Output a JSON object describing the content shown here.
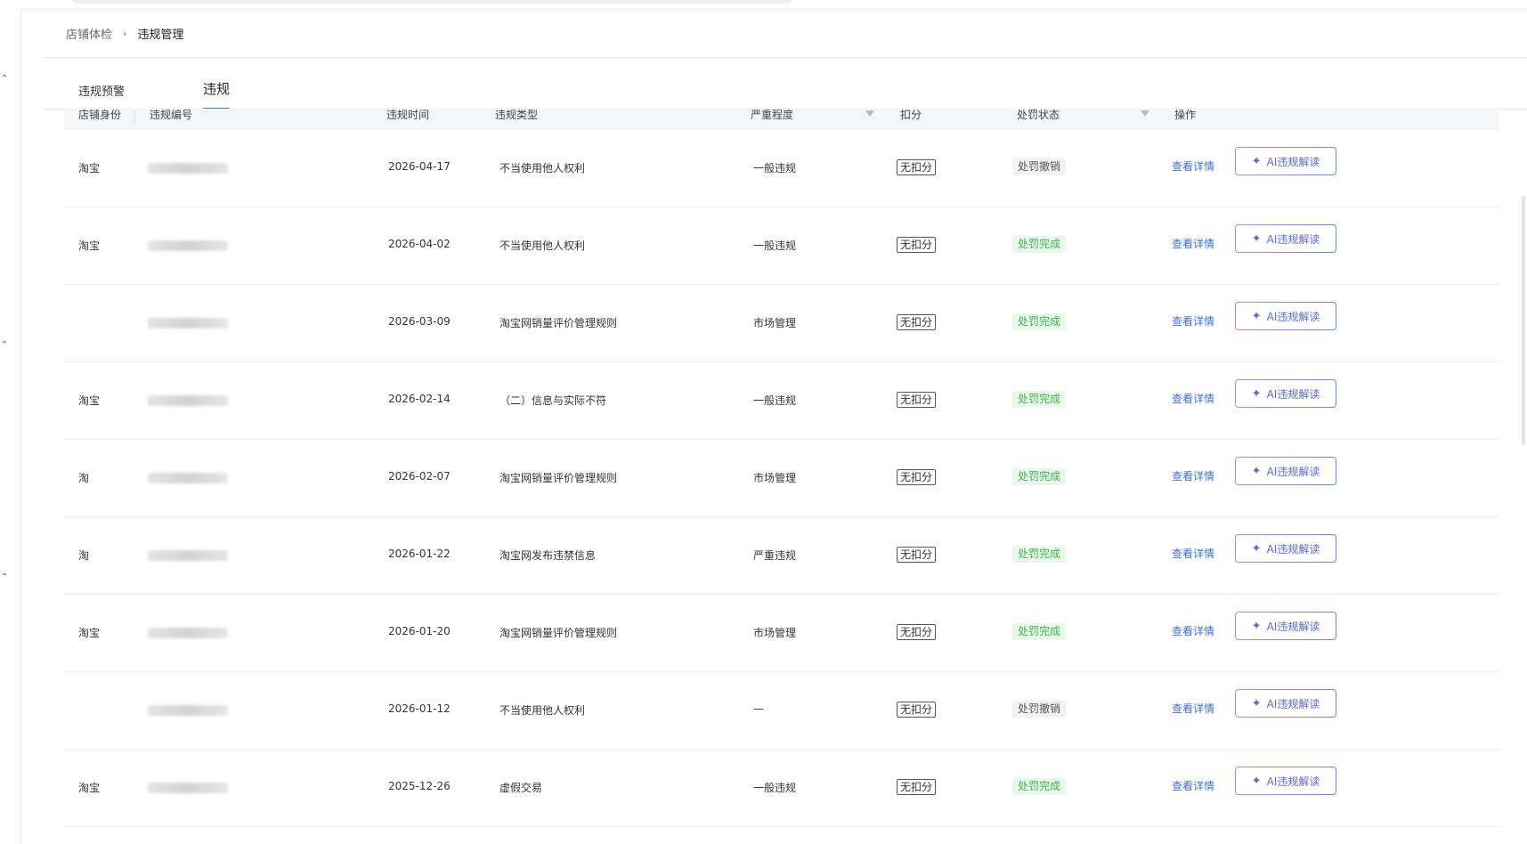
{
  "breadcrumb": {
    "parent": "店铺体检",
    "separator": "›",
    "current": "违规管理"
  },
  "tabs": [
    {
      "label": "违规预警",
      "active": false
    },
    {
      "label": "违规",
      "active": true
    }
  ],
  "table": {
    "headers": {
      "identity": "店铺身份",
      "number": "违规编号",
      "time": "违规时间",
      "type": "违规类型",
      "severity": "严重程度",
      "points": "扣分",
      "status": "处罚状态",
      "actions": "操作"
    },
    "rows": [
      {
        "identity": "淘宝",
        "time": "2026-04-17",
        "type": "不当使用他人权利",
        "severity": "一般违规",
        "points": "无扣分",
        "status": "处罚撤销",
        "status_kind": "revoked"
      },
      {
        "identity": "淘宝",
        "time": "2026-04-02",
        "type": "不当使用他人权利",
        "severity": "一般违规",
        "points": "无扣分",
        "status": "处罚完成",
        "status_kind": "done"
      },
      {
        "identity": "",
        "time": "2026-03-09",
        "type": "淘宝网销量评价管理规则",
        "severity": "市场管理",
        "points": "无扣分",
        "status": "处罚完成",
        "status_kind": "done"
      },
      {
        "identity": "淘宝",
        "time": "2026-02-14",
        "type": "（二）信息与实际不符",
        "severity": "一般违规",
        "points": "无扣分",
        "status": "处罚完成",
        "status_kind": "done"
      },
      {
        "identity": "淘",
        "time": "2026-02-07",
        "type": "淘宝网销量评价管理规则",
        "severity": "市场管理",
        "points": "无扣分",
        "status": "处罚完成",
        "status_kind": "done"
      },
      {
        "identity": "淘",
        "time": "2026-01-22",
        "type": "淘宝网发布违禁信息",
        "severity": "严重违规",
        "points": "无扣分",
        "status": "处罚完成",
        "status_kind": "done"
      },
      {
        "identity": "淘宝",
        "time": "2026-01-20",
        "type": "淘宝网销量评价管理规则",
        "severity": "市场管理",
        "points": "无扣分",
        "status": "处罚完成",
        "status_kind": "done"
      },
      {
        "identity": "",
        "time": "2026-01-12",
        "type": "不当使用他人权利",
        "severity": "—",
        "points": "无扣分",
        "status": "处罚撤销",
        "status_kind": "revoked"
      },
      {
        "identity": "淘宝",
        "time": "2025-12-26",
        "type": "虚假交易",
        "severity": "一般违规",
        "points": "无扣分",
        "status": "处罚完成",
        "status_kind": "done"
      }
    ],
    "detail_label": "查看详情",
    "ai_label": "AI违规解读",
    "ai_icon": "sparkle-icon"
  },
  "colors": {
    "accent": "#3b73e8",
    "link": "#3a6fe0",
    "done_bg": "#eaf8ec",
    "done_fg": "#3bb34a",
    "revoked_bg": "#f2f2f2"
  }
}
